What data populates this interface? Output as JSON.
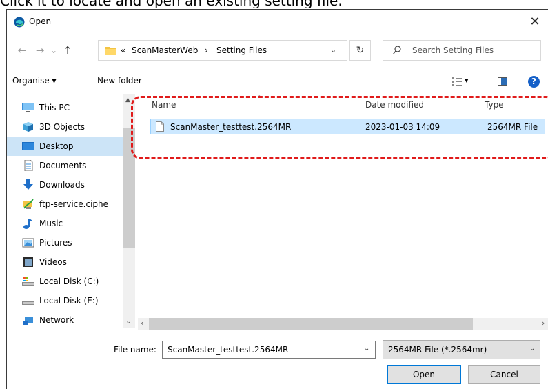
{
  "caption": "Click it to locate and open an existing setting file.",
  "window": {
    "title": "Open",
    "close_glyph": "✕"
  },
  "nav_buttons": {
    "back": "←",
    "forward": "→",
    "recent": "⌄",
    "up": "↑"
  },
  "address": {
    "overflow": "«",
    "crumbs": [
      "ScanMasterWeb",
      "Setting Files"
    ],
    "separator": "›",
    "dropdown_glyph": "⌄"
  },
  "refresh_glyph": "↻",
  "search": {
    "placeholder": "Search Setting Files"
  },
  "toolbar": {
    "organise": "Organise ▾",
    "new_folder": "New folder",
    "view_dropdown": "▾",
    "help": "?"
  },
  "nav_pane": {
    "items": [
      {
        "label": "This PC",
        "icon": "computer-icon"
      },
      {
        "label": "3D Objects",
        "icon": "cube-icon"
      },
      {
        "label": "Desktop",
        "icon": "desktop-icon",
        "selected": true
      },
      {
        "label": "Documents",
        "icon": "document-icon"
      },
      {
        "label": "Downloads",
        "icon": "download-icon"
      },
      {
        "label": "ftp-service.ciphe",
        "icon": "network-drive-icon"
      },
      {
        "label": "Music",
        "icon": "music-icon"
      },
      {
        "label": "Pictures",
        "icon": "pictures-icon"
      },
      {
        "label": "Videos",
        "icon": "videos-icon"
      },
      {
        "label": "Local Disk (C:)",
        "icon": "disk-icon"
      },
      {
        "label": "Local Disk (E:)",
        "icon": "disk-icon"
      },
      {
        "label": "Network",
        "icon": "network-icon"
      }
    ],
    "scroll_up": "▲",
    "scroll_down": "⌄"
  },
  "columns": {
    "name": "Name",
    "date": "Date modified",
    "type": "Type"
  },
  "files": [
    {
      "name": "ScanMaster_testtest.2564MR",
      "date": "2023-01-03 14:09",
      "type": "2564MR File"
    }
  ],
  "hscroll": {
    "left": "‹",
    "right": "›"
  },
  "bottom": {
    "file_name_label": "File name:",
    "file_name_value": "ScanMaster_testtest.2564MR",
    "file_name_arrow": "⌄",
    "file_type": "2564MR File (*.2564mr)",
    "file_type_arrow": "⌄",
    "open": "Open",
    "cancel": "Cancel"
  },
  "colors": {
    "selection": "#cce8ff",
    "selection_border": "#99d1ff",
    "highlight": "#e01b1b",
    "accent": "#0078d7"
  }
}
